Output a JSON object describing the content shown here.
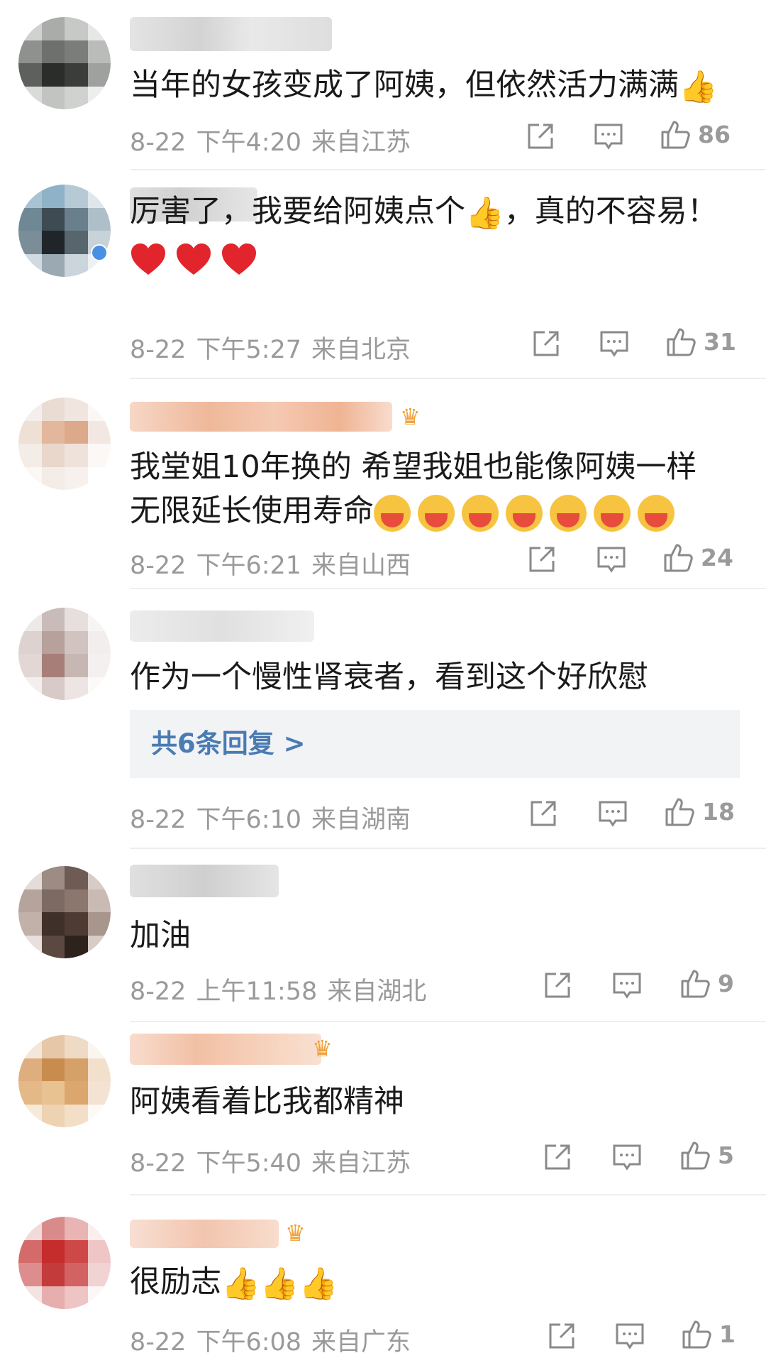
{
  "comments": [
    {
      "text": "当年的女孩变成了阿姨，但依然活力满满",
      "emoji_icon": "thumbs-up-icon",
      "date": "8-22",
      "time": "下午4:20",
      "location": "来自江苏",
      "likes": "86"
    },
    {
      "text_a": "厉害了，我要给阿姨点个",
      "emoji_icon": "thumbs-up-icon",
      "text_b": "，真的不容易！",
      "hearts_icon": "red-heart-icon",
      "date": "8-22",
      "time": "下午5:27",
      "location": "来自北京",
      "likes": "31"
    },
    {
      "text_line1": "我堂姐10年换的 希望我姐也能像阿姨一样",
      "text_line2": "无限延长使用寿命",
      "emoji_icon": "hugging-face-icon",
      "date": "8-22",
      "time": "下午6:21",
      "location": "来自山西",
      "likes": "24"
    },
    {
      "text": "作为一个慢性肾衰者，看到这个好欣慰",
      "replies_label": "共6条回复 >",
      "date": "8-22",
      "time": "下午6:10",
      "location": "来自湖南",
      "likes": "18"
    },
    {
      "text": "加油",
      "date": "8-22",
      "time": "上午11:58",
      "location": "来自湖北",
      "likes": "9"
    },
    {
      "text": "阿姨看着比我都精神",
      "date": "8-22",
      "time": "下午5:40",
      "location": "来自江苏",
      "likes": "5"
    },
    {
      "text": "很励志",
      "emoji_icon": "thumbs-up-icon",
      "date": "8-22",
      "time": "下午6:08",
      "location": "来自广东",
      "likes": "1"
    }
  ],
  "icons": {
    "share": "share-icon",
    "reply": "comment-icon",
    "like": "like-thumb-icon",
    "crown": "vip-crown-icon"
  },
  "colors": {
    "text": "#1a1a1a",
    "meta": "#9a9a9a",
    "link": "#4a7bb3",
    "divider": "#eeeeee",
    "reply_bg": "#f2f3f5"
  }
}
